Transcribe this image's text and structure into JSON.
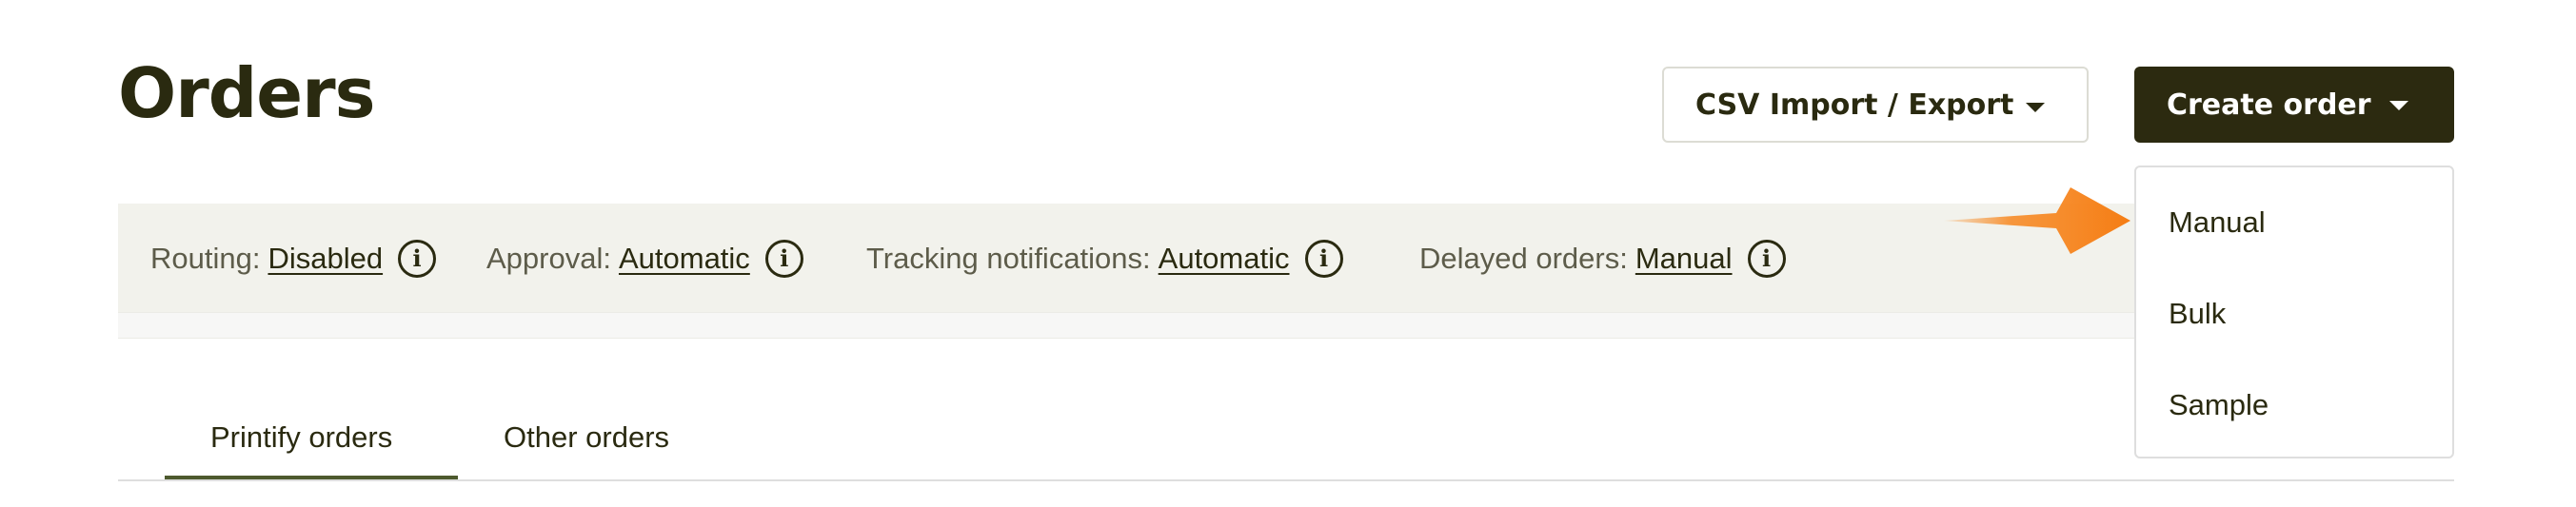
{
  "page": {
    "title": "Orders"
  },
  "actions": {
    "csv_label": "CSV Import / Export",
    "create_label": "Create order"
  },
  "status": [
    {
      "label": "Routing:",
      "value": "Disabled"
    },
    {
      "label": "Approval:",
      "value": "Automatic"
    },
    {
      "label": "Tracking notifications:",
      "value": "Automatic"
    },
    {
      "label": "Delayed orders:",
      "value": "Manual"
    }
  ],
  "info_icon_glyph": "i",
  "tabs": [
    {
      "label": "Printify orders",
      "active": true
    },
    {
      "label": "Other orders",
      "active": false
    }
  ],
  "create_menu": {
    "items": [
      "Manual",
      "Bulk",
      "Sample"
    ]
  },
  "colors": {
    "brand_dark": "#2c2a10",
    "status_bar_bg": "#f2f2ec",
    "tab_active": "#4d5a2e",
    "annotation_arrow": "#f7871f"
  },
  "icons": [
    "chevron-down-icon",
    "info-icon",
    "pointer-arrow-icon"
  ]
}
